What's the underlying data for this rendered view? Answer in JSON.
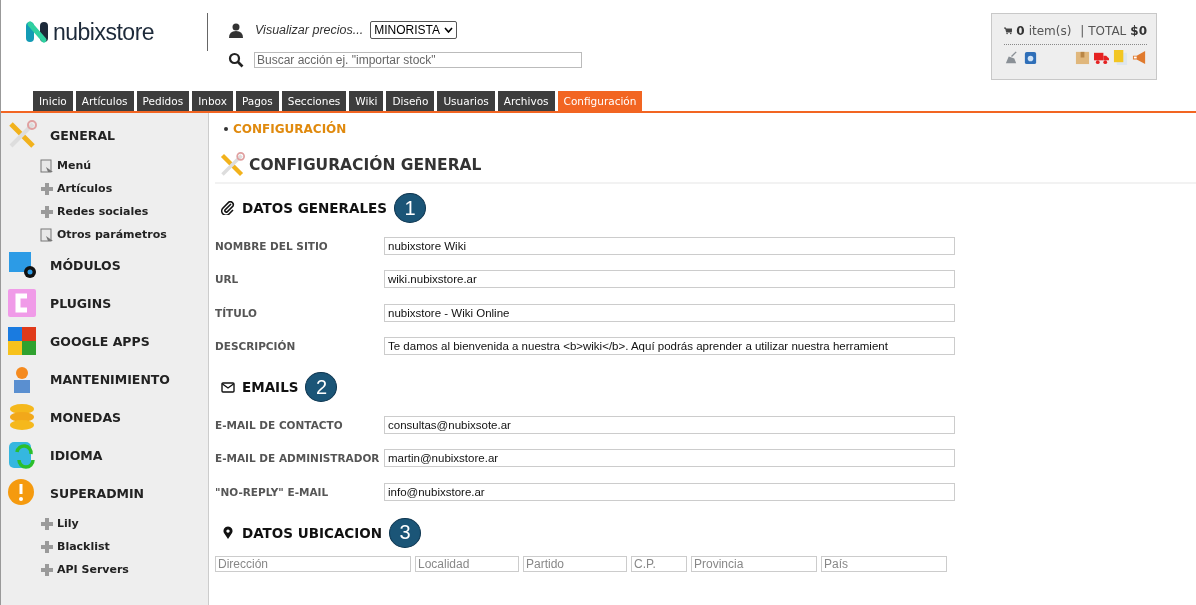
{
  "header": {
    "logo": "nubixstore",
    "price_label": "Visualizar precios...",
    "price_select": "MINORISTA",
    "search": {
      "placeholder": "Buscar acción ej. \"importar stock\""
    },
    "cart": {
      "count": "0",
      "items_label": "item(s)",
      "total_label": "| TOTAL",
      "total": "$0"
    }
  },
  "tabs": [
    {
      "label": "Inicio",
      "selected": false
    },
    {
      "label": "Artículos",
      "selected": false
    },
    {
      "label": "Pedidos",
      "selected": false
    },
    {
      "label": "Inbox",
      "selected": false
    },
    {
      "label": "Pagos",
      "selected": false
    },
    {
      "label": "Secciones",
      "selected": false
    },
    {
      "label": "Wiki",
      "selected": false
    },
    {
      "label": "Diseño",
      "selected": false
    },
    {
      "label": "Usuarios",
      "selected": false
    },
    {
      "label": "Archivos",
      "selected": false
    },
    {
      "label": "Configuración",
      "selected": true
    }
  ],
  "sidebar": {
    "items": [
      {
        "label": "GENERAL",
        "children": [
          {
            "label": "Menú",
            "kind": "page"
          },
          {
            "label": "Artículos",
            "kind": "plus"
          },
          {
            "label": "Redes sociales",
            "kind": "plus"
          },
          {
            "label": "Otros parámetros",
            "kind": "page"
          }
        ]
      },
      {
        "label": "MÓDULOS"
      },
      {
        "label": "PLUGINS"
      },
      {
        "label": "GOOGLE APPS"
      },
      {
        "label": "MANTENIMIENTO"
      },
      {
        "label": "MONEDAS"
      },
      {
        "label": "IDIOMA"
      },
      {
        "label": "SUPERADMIN",
        "children": [
          {
            "label": "Lily",
            "kind": "plus"
          },
          {
            "label": "Blacklist",
            "kind": "plus"
          },
          {
            "label": "API Servers",
            "kind": "plus"
          }
        ]
      }
    ]
  },
  "breadcrumb": "CONFIGURACIÓN",
  "page_title": "CONFIGURACIÓN GENERAL",
  "sections": [
    {
      "kind": "clip",
      "title": "DATOS GENERALES",
      "number": "1",
      "fields": [
        {
          "label": "NOMBRE DEL SITIO",
          "value": "nubixstore Wiki"
        },
        {
          "label": "URL",
          "value": "wiki.nubixstore.ar"
        },
        {
          "label": "TÍTULO",
          "value": "nubixstore - Wiki Online"
        },
        {
          "label": "DESCRIPCIÓN",
          "value": "Te damos al bienvenida a nuestra <b>wiki</b>. Aquí podrás aprender a utilizar nuestra herramient"
        }
      ]
    },
    {
      "kind": "mail",
      "title": "EMAILS",
      "number": "2",
      "fields": [
        {
          "label": "E-MAIL DE CONTACTO",
          "value": "consultas@nubixsote.ar"
        },
        {
          "label": "E-MAIL DE ADMINISTRADOR",
          "value": "martin@nubixstore.ar"
        },
        {
          "label": "\"NO-REPLY\" E-MAIL",
          "value": "info@nubixstore.ar"
        }
      ]
    },
    {
      "kind": "pin",
      "title": "DATOS UBICACION",
      "number": "3",
      "placeholders": [
        "Dirección",
        "Localidad",
        "Partido",
        "C.P.",
        "Provincia",
        "País"
      ]
    }
  ]
}
